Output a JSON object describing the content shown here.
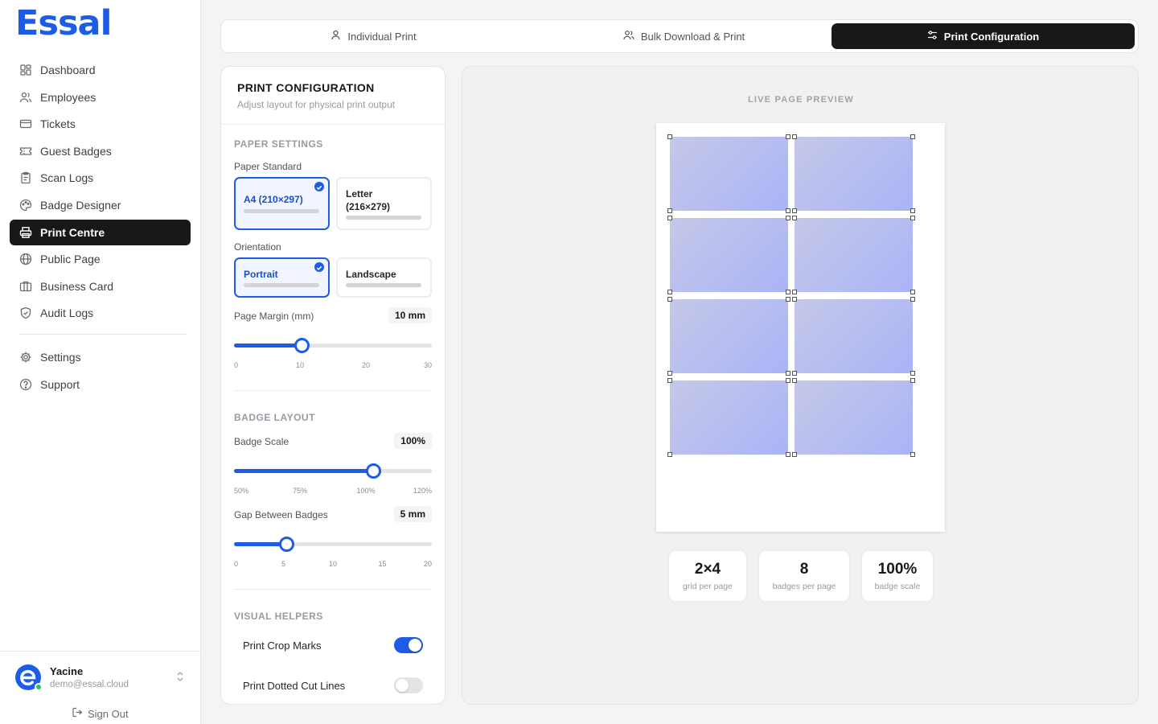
{
  "brand": {
    "logo_text": "Essal",
    "color": "#1c5ce6"
  },
  "sidebar": {
    "items": [
      {
        "label": "Dashboard",
        "icon": "grid-icon"
      },
      {
        "label": "Employees",
        "icon": "users-icon"
      },
      {
        "label": "Tickets",
        "icon": "ticket-icon"
      },
      {
        "label": "Guest Badges",
        "icon": "badge-icon"
      },
      {
        "label": "Scan Logs",
        "icon": "clipboard-icon"
      },
      {
        "label": "Badge Designer",
        "icon": "palette-icon"
      },
      {
        "label": "Print Centre",
        "icon": "printer-icon",
        "active": true
      },
      {
        "label": "Public Page",
        "icon": "globe-icon"
      },
      {
        "label": "Business Card",
        "icon": "card-icon"
      },
      {
        "label": "Audit Logs",
        "icon": "shield-icon"
      }
    ],
    "secondary": [
      {
        "label": "Settings",
        "icon": "gear-icon"
      },
      {
        "label": "Support",
        "icon": "help-icon"
      }
    ],
    "user": {
      "name": "Yacine",
      "email": "demo@essal.cloud",
      "online": true
    },
    "sign_out_label": "Sign Out"
  },
  "tabs": [
    {
      "label": "Individual Print",
      "icon": "user-icon",
      "active": false
    },
    {
      "label": "Bulk Download & Print",
      "icon": "users-icon",
      "active": false
    },
    {
      "label": "Print Configuration",
      "icon": "sliders-icon",
      "active": true
    }
  ],
  "config": {
    "title": "PRINT CONFIGURATION",
    "subtitle": "Adjust layout for physical print output",
    "paper_section": "PAPER SETTINGS",
    "paper_standard_label": "Paper Standard",
    "paper_options": [
      {
        "label": "A4 (210×297)",
        "selected": true
      },
      {
        "label": "Letter (216×279)",
        "selected": false
      }
    ],
    "orientation_label": "Orientation",
    "orientation_options": [
      {
        "label": "Portrait",
        "selected": true
      },
      {
        "label": "Landscape",
        "selected": false
      }
    ],
    "margin_label": "Page Margin (mm)",
    "margin_value_text": "10 mm",
    "margin": {
      "value": 10,
      "min": 0,
      "max": 30,
      "ticks": [
        "0",
        "10",
        "20",
        "30"
      ]
    },
    "layout_section": "BADGE LAYOUT",
    "scale_label": "Badge Scale",
    "scale_value_text": "100%",
    "scale": {
      "value": 100,
      "min": 50,
      "max": 120,
      "ticks": [
        "50%",
        "75%",
        "100%",
        "120%"
      ]
    },
    "gap_label": "Gap Between Badges",
    "gap_value_text": "5 mm",
    "gap": {
      "value": 5,
      "min": 0,
      "max": 20,
      "ticks": [
        "0",
        "5",
        "10",
        "15",
        "20"
      ]
    },
    "helpers_section": "VISUAL HELPERS",
    "crop_marks_label": "Print Crop Marks",
    "crop_marks_on": true,
    "cut_lines_label": "Print Dotted Cut Lines",
    "cut_lines_on": false
  },
  "preview": {
    "label": "LIVE PAGE PREVIEW",
    "columns": 2,
    "rows": 4,
    "badge_gradient": [
      "#c5c8e8",
      "#aab4f7"
    ],
    "stats": [
      {
        "value": "2×4",
        "label": "grid per page"
      },
      {
        "value": "8",
        "label": "badges per page"
      },
      {
        "value": "100%",
        "label": "badge scale"
      }
    ]
  }
}
